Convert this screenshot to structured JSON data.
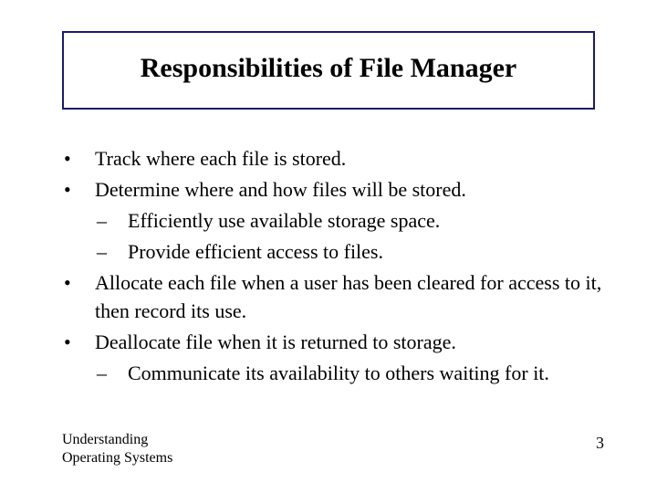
{
  "title": "Responsibilities of File Manager",
  "items": [
    {
      "text": "Track where each file is stored.",
      "sub": []
    },
    {
      "text": "Determine where and how files will be stored.",
      "sub": [
        "Efficiently use available storage space.",
        "Provide efficient access to files."
      ]
    },
    {
      "text": "Allocate each file when a user has been cleared for access to it, then record its use.",
      "sub": []
    },
    {
      "text": "Deallocate file when it is returned to storage.",
      "sub": [
        "Communicate its availability to others waiting for it."
      ]
    }
  ],
  "footer": {
    "line1": "Understanding",
    "line2": "Operating Systems",
    "page": "3"
  }
}
